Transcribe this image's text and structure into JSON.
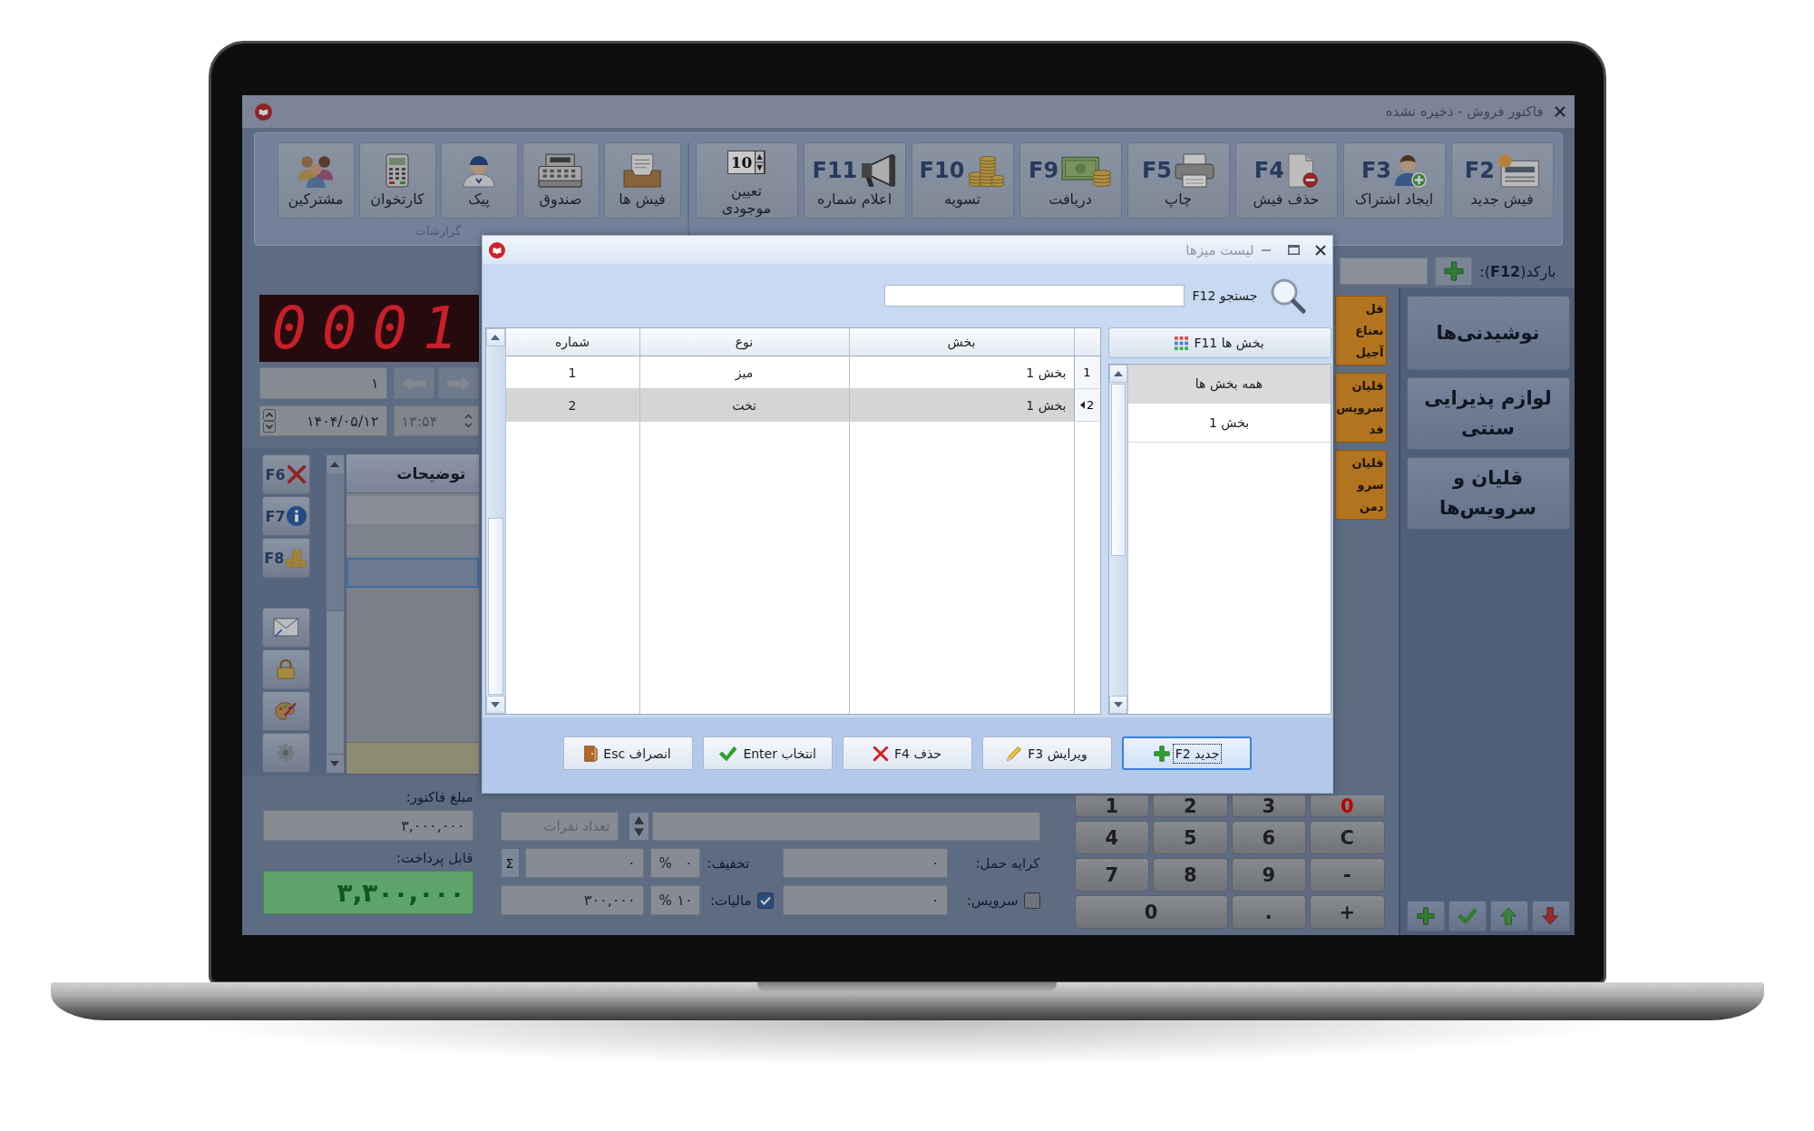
{
  "window": {
    "title": "فاکتور فروش - ذخیره نشده"
  },
  "ribbon": {
    "groups": [
      {
        "buttons": [
          {
            "key": "F2",
            "label": "فیش جدید"
          },
          {
            "key": "F3",
            "label": "ایجاد اشتراک"
          },
          {
            "key": "F4",
            "label": "حذف فیش"
          },
          {
            "key": "F5",
            "label": "چاپ"
          },
          {
            "key": "F9",
            "label": "دریافت"
          },
          {
            "key": "F10",
            "label": "تسویه"
          },
          {
            "key": "F11",
            "label": "اعلام شماره"
          },
          {
            "label": "تعیین موجودی",
            "spinner_value": "10"
          }
        ]
      },
      {
        "label": "گزارشات",
        "buttons": [
          {
            "label": "فیش ها"
          },
          {
            "label": "صندوق"
          },
          {
            "label": "پیک"
          },
          {
            "label": "کارتخوان"
          },
          {
            "label": "مشترکین"
          }
        ]
      }
    ]
  },
  "barcode": {
    "label": "بارکد(**F12**):"
  },
  "counter": {
    "value": "0001"
  },
  "invoice_number": {
    "value": "۱"
  },
  "date": {
    "value": "۱۴۰۴/۰۵/۱۲"
  },
  "time": {
    "value": "۱۳:۵۴",
    "disabled": true
  },
  "side_buttons": [
    {
      "key": "F6"
    },
    {
      "key": "F7"
    },
    {
      "key": "F8"
    }
  ],
  "items_grid": {
    "columns": [
      "توضیحات"
    ],
    "rows": [
      {
        "selected": false
      },
      {
        "selected": false
      },
      {
        "selected": true
      }
    ]
  },
  "product_tiles": [
    {
      "lines": [
        "قل",
        "نعناع",
        "آجیل"
      ]
    },
    {
      "lines": [
        "قلیان",
        "سرویس",
        "فد"
      ]
    },
    {
      "lines": [
        "قلیان",
        "سرو",
        "دمن"
      ]
    }
  ],
  "categories": [
    {
      "label": "نوشیدنی‌ها"
    },
    {
      "label": "لوازم پذیرایی سنتی"
    },
    {
      "label": "قلیان و سرویس‌ها"
    }
  ],
  "totals": {
    "invoice_amount": {
      "label": "مبلغ فاکتور:",
      "value": "۳,۰۰۰,۰۰۰"
    },
    "payable": {
      "label": "قابل پرداخت:",
      "value": "۳,۳۰۰,۰۰۰"
    }
  },
  "order_form": {
    "people_count": {
      "placeholder": "تعداد نفرات"
    },
    "sum_button": "Σ",
    "discount": {
      "label": "تخفیف:",
      "percent_sign": "%",
      "percent": "۰",
      "amount": "۰"
    },
    "shipping": {
      "label": "کرایه حمل:",
      "value": "۰"
    },
    "tax": {
      "label": "مالیات:",
      "checked": true,
      "percent_sign": "%",
      "percent": "۱۰",
      "amount": "۳۰۰,۰۰۰"
    },
    "service": {
      "label": "سرویس:",
      "checked": false,
      "value": "۰"
    }
  },
  "keypad": {
    "rows": [
      [
        {
          "label": "0",
          "color": "#c00000"
        },
        {
          "label": "3",
          "color": "#1e1e1e"
        },
        {
          "label": "2",
          "color": "#1e1e1e"
        },
        {
          "label": "1",
          "color": "#1e1e1e"
        }
      ],
      [
        {
          "label": "C",
          "color": "#1e1e1e"
        },
        {
          "label": "6",
          "color": "#1e1e1e"
        },
        {
          "label": "5",
          "color": "#1e1e1e"
        },
        {
          "label": "4",
          "color": "#1e1e1e"
        }
      ],
      [
        {
          "label": "-",
          "color": "#1e1e1e"
        },
        {
          "label": "9",
          "color": "#1e1e1e"
        },
        {
          "label": "8",
          "color": "#1e1e1e"
        },
        {
          "label": "7",
          "color": "#1e1e1e"
        }
      ],
      [
        {
          "label": "+",
          "color": "#1e1e1e"
        },
        {
          "label": ".",
          "color": "#1e1e1e"
        },
        {
          "label": "0",
          "color": "#1e1e1e"
        }
      ]
    ]
  },
  "dialog": {
    "title": "لیست میزها",
    "search": {
      "label": "جستجو F12"
    },
    "tables": {
      "columns": [
        "بخش",
        "نوع",
        "شماره"
      ],
      "rows": [
        {
          "row_number": "1",
          "cells": [
            "بخش 1",
            "میز",
            "1"
          ],
          "selected": false
        },
        {
          "row_number": "2",
          "cells": [
            "بخش 1",
            "تخت",
            "2"
          ],
          "selected": true
        }
      ]
    },
    "sections": {
      "button": "بخش ها F11",
      "items": [
        {
          "label": "همه بخش ها",
          "selected": true
        },
        {
          "label": "بخش 1",
          "selected": false
        }
      ]
    },
    "buttons": [
      {
        "label": "جدید F2",
        "focused": true
      },
      {
        "label": "ویرایش F3",
        "focused": false
      },
      {
        "label": "حذف F4",
        "focused": false
      },
      {
        "label": "انتخاب Enter",
        "focused": false
      },
      {
        "label": "انصراف Esc",
        "focused": false
      }
    ]
  }
}
